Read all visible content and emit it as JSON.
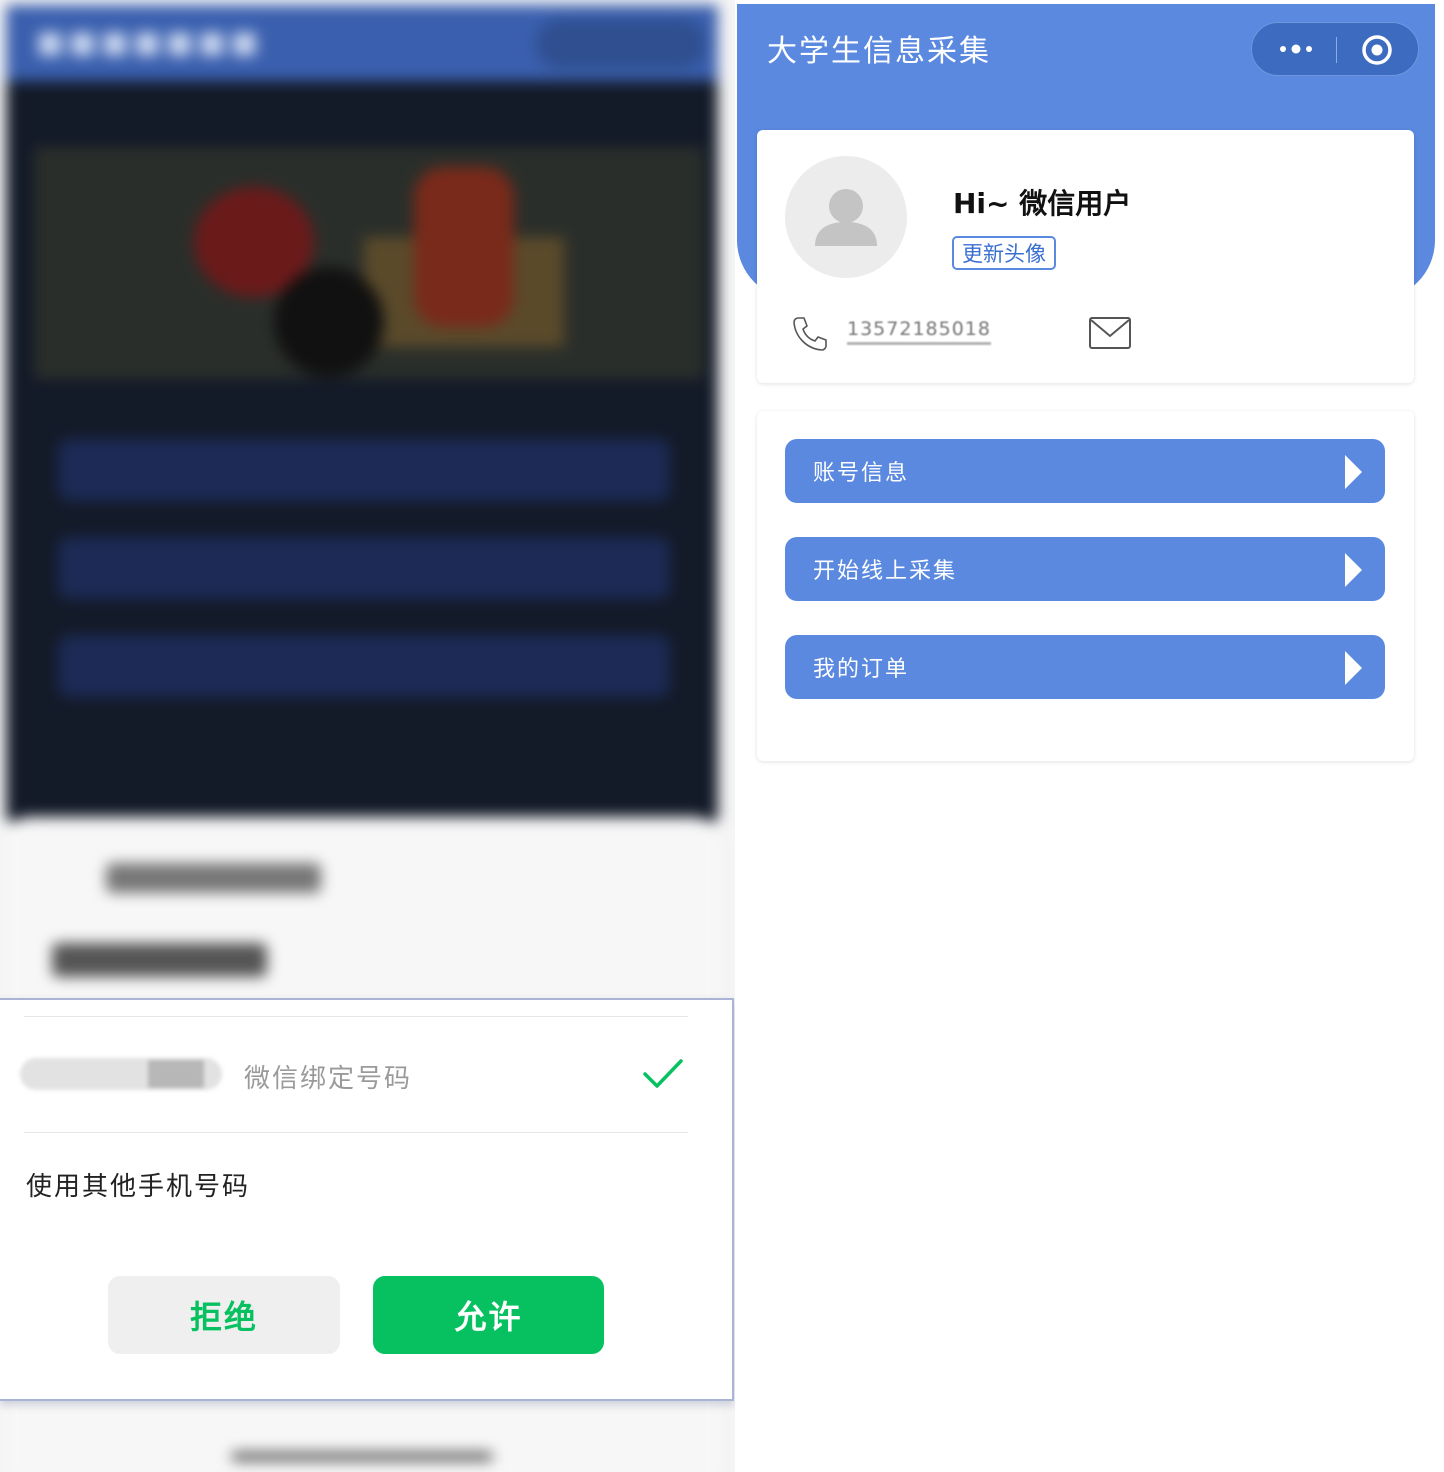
{
  "left": {
    "dialog": {
      "bound_label": "微信绑定号码",
      "other_phone": "使用其他手机号码",
      "reject": "拒绝",
      "allow": "允许"
    },
    "icons": [
      "check-icon"
    ],
    "colors": {
      "wechat_green": "#07c160"
    }
  },
  "right": {
    "app_title": "大学生信息采集",
    "profile": {
      "greeting": "Hi~ 微信用户",
      "update_avatar": "更新头像",
      "phone": "13572185018"
    },
    "menu": [
      {
        "label": "账号信息"
      },
      {
        "label": "开始线上采集"
      },
      {
        "label": "我的订单"
      }
    ],
    "icons": [
      "more-icon",
      "target-icon",
      "avatar-icon",
      "phone-icon",
      "mail-icon",
      "arrow-right-icon"
    ],
    "colors": {
      "brand_blue": "#5b89e0",
      "capsule": "#3d6bc0"
    }
  }
}
